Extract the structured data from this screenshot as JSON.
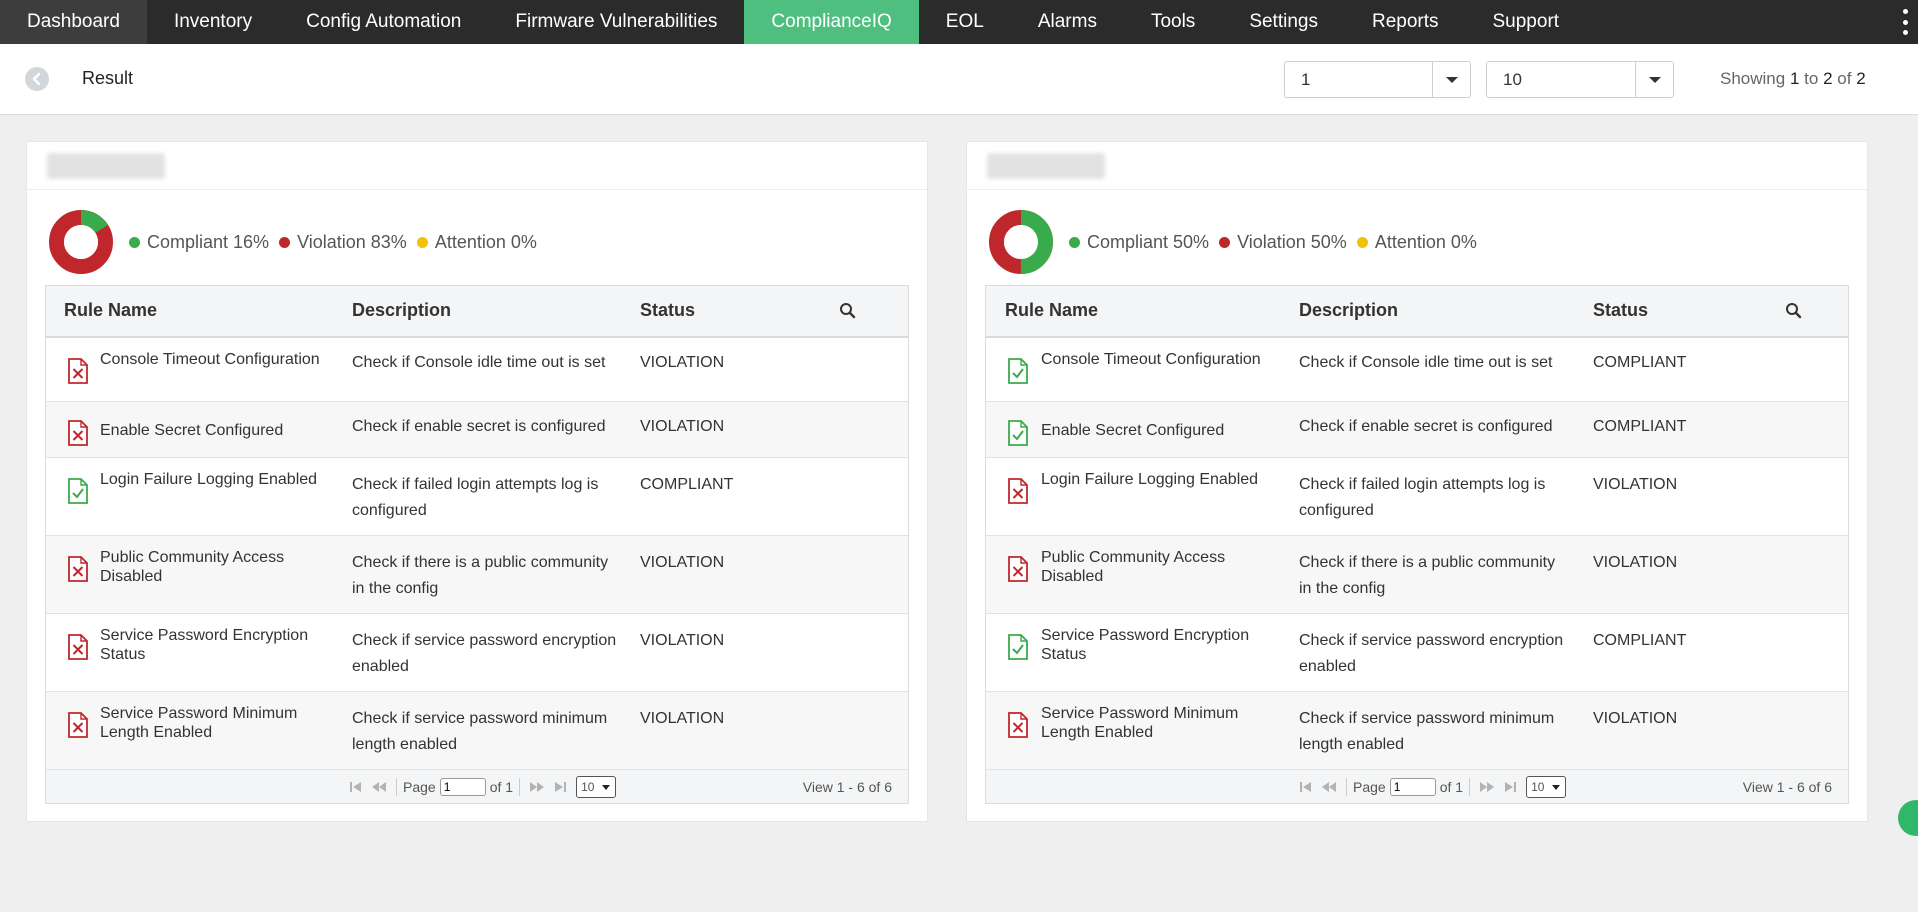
{
  "nav": {
    "items": [
      "Dashboard",
      "Inventory",
      "Config Automation",
      "Firmware Vulnerabilities",
      "ComplianceIQ",
      "EOL",
      "Alarms",
      "Tools",
      "Settings",
      "Reports",
      "Support"
    ],
    "active": "ComplianceIQ",
    "active_color": "#4fbf7f",
    "menu_icon": "kebab-menu-icon"
  },
  "result_bar": {
    "title": "Result",
    "back_icon": "chevron-left-icon",
    "page_select": "1",
    "per_page_select": "10",
    "showing_prefix": "Showing",
    "showing_from": "1",
    "showing_to_word": "to",
    "showing_to": "2",
    "showing_of_word": "of",
    "showing_total": "2"
  },
  "colors": {
    "compliant": "#3aab4a",
    "violation": "#c0272d",
    "attention": "#f2c200"
  },
  "table_headers": {
    "rule_name": "Rule Name",
    "description": "Description",
    "status": "Status",
    "search_icon": "search-icon"
  },
  "panels": [
    {
      "device_name": "",
      "summary": {
        "compliant_pct": 16,
        "violation_pct": 83,
        "attention_pct": 0
      },
      "legend": {
        "compliant": "Compliant 16%",
        "violation": "Violation 83%",
        "attention": "Attention 0%"
      },
      "rows": [
        {
          "rule": "Console Timeout Configuration",
          "description": "Check if Console idle time out is set",
          "status": "VIOLATION"
        },
        {
          "rule": "Enable Secret Configured",
          "description": "Check if enable secret is configured",
          "status": "VIOLATION"
        },
        {
          "rule": "Login Failure Logging Enabled",
          "description": "Check if failed login attempts log is configured",
          "status": "COMPLIANT"
        },
        {
          "rule": "Public Community Access Disabled",
          "description": "Check if there is a public community in the config",
          "status": "VIOLATION"
        },
        {
          "rule": "Service Password Encryption Status",
          "description": "Check if service password encryption enabled",
          "status": "VIOLATION"
        },
        {
          "rule": "Service Password Minimum Length Enabled",
          "description": "Check if service password minimum length enabled",
          "status": "VIOLATION"
        }
      ],
      "pager": {
        "page_label": "Page",
        "page": "1",
        "of_label": "of 1",
        "per_page": "10",
        "view": "View 1 - 6 of 6"
      }
    },
    {
      "device_name": "",
      "summary": {
        "compliant_pct": 50,
        "violation_pct": 50,
        "attention_pct": 0
      },
      "legend": {
        "compliant": "Compliant 50%",
        "violation": "Violation 50%",
        "attention": "Attention 0%"
      },
      "rows": [
        {
          "rule": "Console Timeout Configuration",
          "description": "Check if Console idle time out is set",
          "status": "COMPLIANT"
        },
        {
          "rule": "Enable Secret Configured",
          "description": "Check if enable secret is configured",
          "status": "COMPLIANT"
        },
        {
          "rule": "Login Failure Logging Enabled",
          "description": "Check if failed login attempts log is configured",
          "status": "VIOLATION"
        },
        {
          "rule": "Public Community Access Disabled",
          "description": "Check if there is a public community in the config",
          "status": "VIOLATION"
        },
        {
          "rule": "Service Password Encryption Status",
          "description": "Check if service password encryption enabled",
          "status": "COMPLIANT"
        },
        {
          "rule": "Service Password Minimum Length Enabled",
          "description": "Check if service password minimum length enabled",
          "status": "VIOLATION"
        }
      ],
      "pager": {
        "page_label": "Page",
        "page": "1",
        "of_label": "of 1",
        "per_page": "10",
        "view": "View 1 - 6 of 6"
      }
    }
  ],
  "chat_icon": "chat-icon"
}
